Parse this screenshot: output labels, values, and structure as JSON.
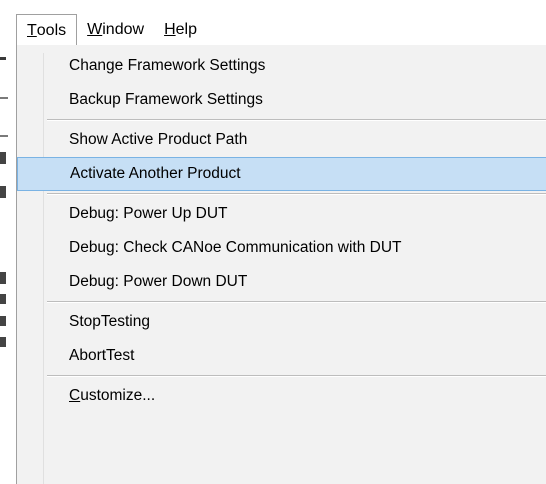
{
  "menubar": {
    "items": [
      {
        "pre": "",
        "mnemonic": "T",
        "post": "ools"
      },
      {
        "pre": "",
        "mnemonic": "W",
        "post": "indow"
      },
      {
        "pre": "",
        "mnemonic": "H",
        "post": "elp"
      }
    ]
  },
  "tools_menu": {
    "items": [
      {
        "label": "Change Framework Settings"
      },
      {
        "label": "Backup Framework Settings"
      },
      {
        "label": "Show Active Product Path"
      },
      {
        "label": "Activate Another Product",
        "highlighted": true
      },
      {
        "label": "Debug: Power Up DUT"
      },
      {
        "label": "Debug: Check CANoe Communication with DUT"
      },
      {
        "label": "Debug: Power Down DUT"
      },
      {
        "label": "StopTesting"
      },
      {
        "label": "AbortTest"
      },
      {
        "mnemonic": "C",
        "post": "ustomize..."
      }
    ]
  },
  "colors": {
    "highlight_bg": "#c6dff5",
    "highlight_border": "#7ab3e4",
    "menu_bg": "#f2f2f2"
  }
}
